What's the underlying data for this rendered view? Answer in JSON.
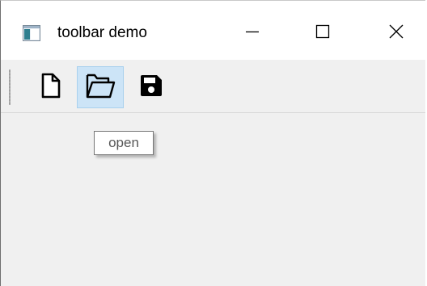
{
  "window": {
    "title": "toolbar demo",
    "app_icon": "window-app-icon",
    "controls": {
      "minimize_icon": "minimize-icon",
      "maximize_icon": "maximize-icon",
      "close_icon": "close-icon"
    }
  },
  "toolbar": {
    "items": [
      {
        "icon": "new-file-icon",
        "state": "normal"
      },
      {
        "icon": "open-folder-icon",
        "state": "hover"
      },
      {
        "icon": "save-icon",
        "state": "normal"
      }
    ]
  },
  "tooltip": {
    "text": "open"
  },
  "colors": {
    "titlebar": "#ffffff",
    "client": "#f0f0f0",
    "hover_highlight": "#cce4f7",
    "hover_border": "#a8d0ee"
  }
}
